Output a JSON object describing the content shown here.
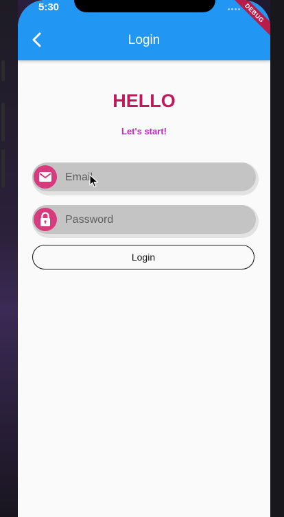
{
  "status_bar": {
    "time": "5:30",
    "debug_banner": "DEBUG"
  },
  "app_bar": {
    "title": "Login",
    "back_icon": "chevron-left-icon",
    "color": "#2196f3"
  },
  "greeting": {
    "title": "HELLO",
    "subtitle": "Let's start!",
    "title_color": "#c2185b",
    "subtitle_color": "#c028c4"
  },
  "form": {
    "email": {
      "placeholder": "Email",
      "value": "",
      "icon": "envelope-icon"
    },
    "password": {
      "placeholder": "Password",
      "value": "",
      "icon": "lock-icon"
    },
    "submit_label": "Login",
    "icon_color": "#d63b7d"
  }
}
